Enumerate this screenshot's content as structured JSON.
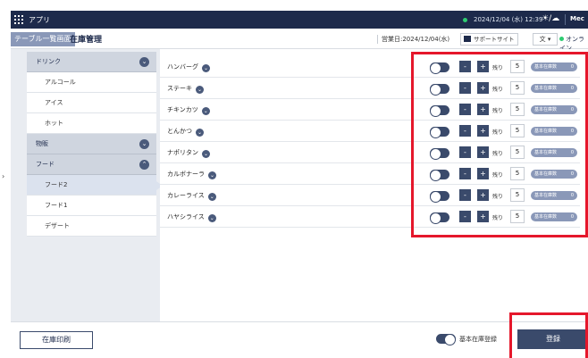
{
  "topbar": {
    "app_label": "アプリ",
    "datetime": "2024/12/04 (水) 12:39",
    "weather": "☀/☁",
    "store_label": "Mec"
  },
  "header": {
    "back_tab": "テーブル一覧画面",
    "title": "在庫管理",
    "business_date": "営業日:2024/12/04(水)",
    "support_label": "サポートサイト",
    "lang_label": "文",
    "status_label": "オンライン"
  },
  "sidebar": {
    "cat_drink": "ドリンク",
    "sub_alcohol": "アルコール",
    "sub_ice": "アイス",
    "sub_hot": "ホット",
    "cat_goods": "物販",
    "cat_food": "フード",
    "sub_food2": "フード2",
    "sub_food1": "フード1",
    "sub_dessert": "デザート"
  },
  "items": [
    {
      "name": "ハンバーグ",
      "remain_label": "残り",
      "qty": "5",
      "base_label": "基本在庫数",
      "base_value": "0"
    },
    {
      "name": "ステーキ",
      "remain_label": "残り",
      "qty": "5",
      "base_label": "基本在庫数",
      "base_value": "0"
    },
    {
      "name": "チキンカツ",
      "remain_label": "残り",
      "qty": "5",
      "base_label": "基本在庫数",
      "base_value": "0"
    },
    {
      "name": "とんかつ",
      "remain_label": "残り",
      "qty": "5",
      "base_label": "基本在庫数",
      "base_value": "0"
    },
    {
      "name": "ナポリタン",
      "remain_label": "残り",
      "qty": "5",
      "base_label": "基本在庫数",
      "base_value": "0"
    },
    {
      "name": "カルボナーラ",
      "remain_label": "残り",
      "qty": "5",
      "base_label": "基本在庫数",
      "base_value": "0"
    },
    {
      "name": "カレーライス",
      "remain_label": "残り",
      "qty": "5",
      "base_label": "基本在庫数",
      "base_value": "0"
    },
    {
      "name": "ハヤシライス",
      "remain_label": "残り",
      "qty": "5",
      "base_label": "基本在庫数",
      "base_value": "0"
    }
  ],
  "controls": {
    "minus": "-",
    "plus": "+",
    "chev": "⌄"
  },
  "footer": {
    "print_label": "在庫印刷",
    "base_register_label": "基本在庫登録",
    "register_label": "登録"
  },
  "side_mark": "›",
  "colors": {
    "navy": "#1d2a4b",
    "accent": "#3a4a6b",
    "highlight": "#e5172b",
    "online": "#2ecc71"
  }
}
